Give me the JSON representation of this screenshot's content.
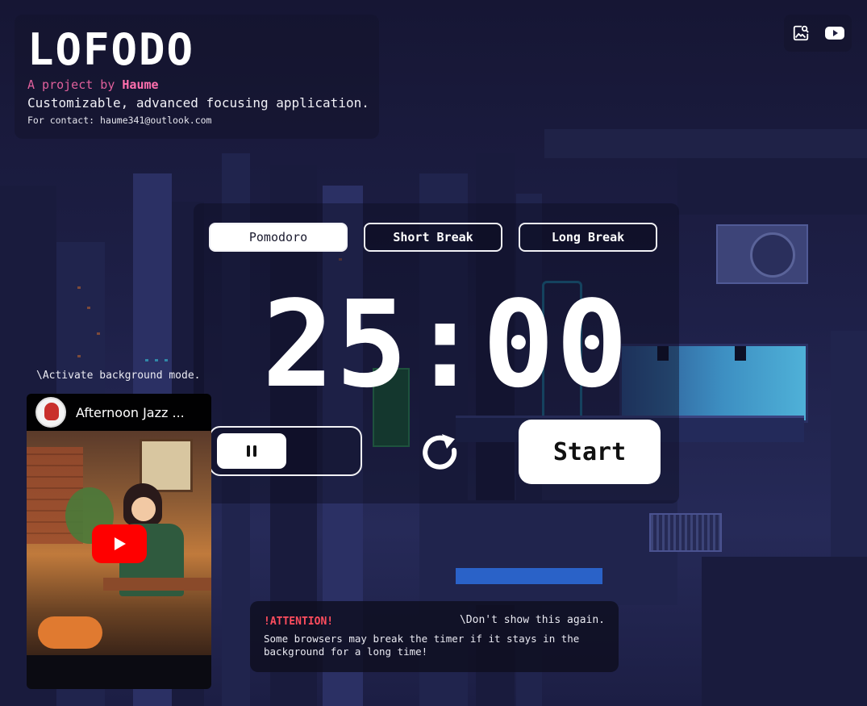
{
  "app": {
    "logo": "LOFODO",
    "byline_prefix": "A project by",
    "author": "Haume",
    "tagline": "Customizable, advanced focusing application.",
    "contact": "For contact: haume341@outlook.com"
  },
  "top_buttons": {
    "icons": [
      "image-search-icon",
      "youtube-icon"
    ]
  },
  "modes": [
    {
      "label": "Pomodoro",
      "active": true
    },
    {
      "label": "Short Break",
      "active": false
    },
    {
      "label": "Long Break",
      "active": false
    }
  ],
  "timer": {
    "display": "25:00"
  },
  "controls": {
    "pause_icon": "pause-icon",
    "reset_icon": "reset-icon",
    "start_label": "Start"
  },
  "background_mode_link": "\\Activate background mode.",
  "youtube": {
    "title": "Afternoon Jazz ...",
    "play_icon": "youtube-play-icon"
  },
  "attention": {
    "title": "!ATTENTION!",
    "dismiss": "\\Don't show this again.",
    "body": "Some browsers may break the timer if it stays in the background for a long time!"
  },
  "colors": {
    "accent_pink": "#ff6fae",
    "attention_red": "#ff4d5e",
    "youtube_red": "#ff0000"
  }
}
